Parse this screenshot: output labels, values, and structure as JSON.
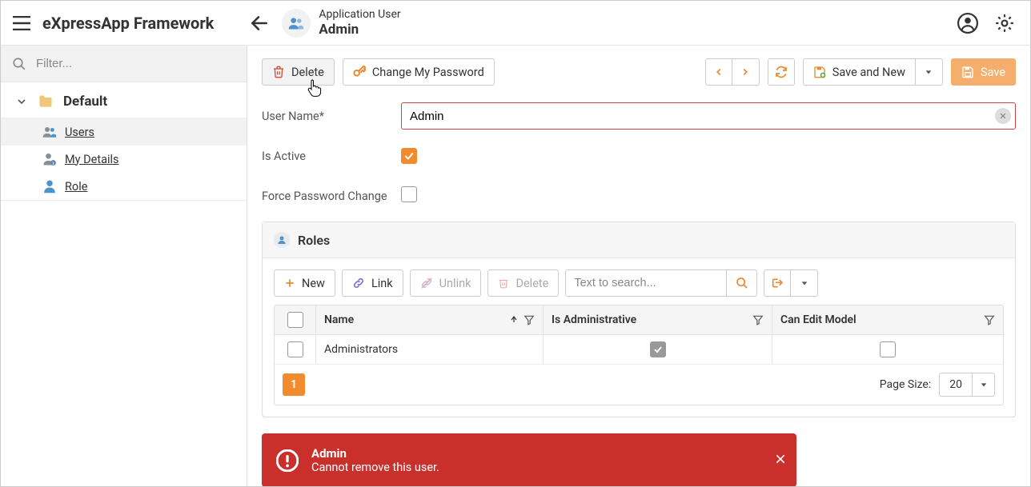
{
  "app_title": "eXpressApp Framework",
  "header": {
    "entity_type": "Application User",
    "entity_name": "Admin"
  },
  "sidebar": {
    "filter_placeholder": "Filter...",
    "group_label": "Default",
    "items": [
      {
        "label": "Users",
        "icon": "users",
        "active": true
      },
      {
        "label": "My Details",
        "icon": "mydetails",
        "active": false
      },
      {
        "label": "Role",
        "icon": "role",
        "active": false
      }
    ]
  },
  "actions": {
    "delete_label": "Delete",
    "change_password_label": "Change My Password",
    "save_and_new_label": "Save and New",
    "save_label": "Save"
  },
  "form": {
    "username_label": "User Name*",
    "username_value": "Admin",
    "isactive_label": "Is Active",
    "isactive_value": true,
    "force_pwd_label": "Force Password Change",
    "force_pwd_value": false
  },
  "roles_panel": {
    "title": "Roles",
    "toolbar": {
      "new_label": "New",
      "link_label": "Link",
      "unlink_label": "Unlink",
      "delete_label": "Delete",
      "search_placeholder": "Text to search..."
    },
    "columns": {
      "name": "Name",
      "is_admin": "Is Administrative",
      "can_edit": "Can Edit Model"
    },
    "rows": [
      {
        "name": "Administrators",
        "is_admin": true,
        "can_edit": false
      }
    ],
    "footer": {
      "current_page": "1",
      "page_size_label": "Page Size:",
      "page_size_value": "20"
    }
  },
  "toast": {
    "title": "Admin",
    "message": "Cannot remove this user."
  }
}
